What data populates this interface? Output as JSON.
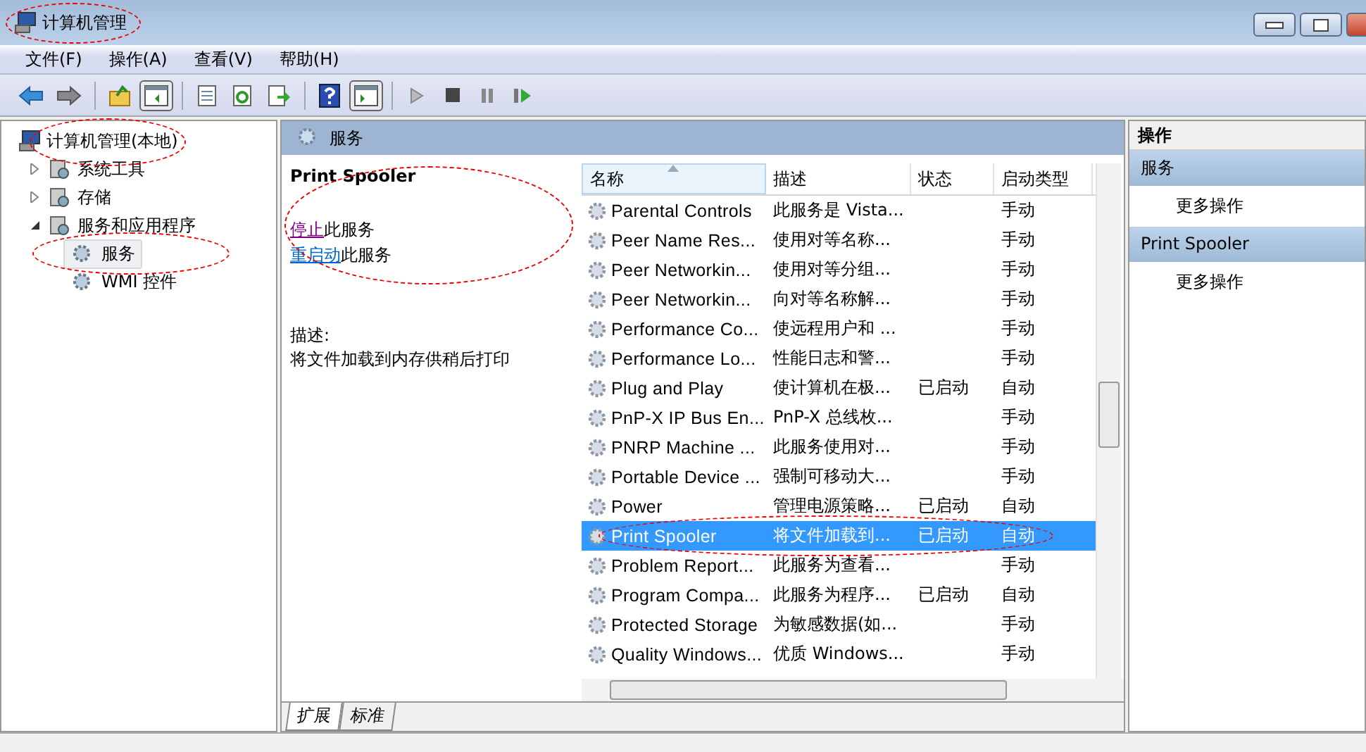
{
  "window": {
    "title": "计算机管理",
    "circled": true
  },
  "menu": [
    "文件(F)",
    "操作(A)",
    "查看(V)",
    "帮助(H)"
  ],
  "tree": [
    {
      "label": "计算机管理(本地)",
      "circled": true,
      "children": [
        {
          "label": "系统工具",
          "expanded": false
        },
        {
          "label": "存储",
          "expanded": false
        },
        {
          "label": "服务和应用程序",
          "expanded": true,
          "children": [
            {
              "label": "服务",
              "selected": true,
              "circled": true
            },
            {
              "label": "WMI 控件",
              "selected": false,
              "circled": false
            }
          ]
        }
      ]
    }
  ],
  "header": {
    "title": "服务"
  },
  "details": {
    "name": "Print Spooler",
    "circled": true,
    "links": [
      {
        "link": "停止",
        "rest": "此服务",
        "visited": true
      },
      {
        "link": "重启动",
        "rest": "此服务",
        "visited": false
      }
    ],
    "description_label": "描述:",
    "description": "将文件加载到内存供稍后打印"
  },
  "table": {
    "columns": [
      {
        "label": "名称",
        "sorted": true
      },
      {
        "label": "描述",
        "sorted": false
      },
      {
        "label": "状态",
        "sorted": false
      },
      {
        "label": "启动类型",
        "sorted": false
      }
    ],
    "rows": [
      {
        "name": "Parental Controls",
        "description": "此服务是 Vista...",
        "startup": "手动",
        "selected": false,
        "circled": false
      },
      {
        "name": "Peer Name Res...",
        "description": "使用对等名称...",
        "startup": "手动",
        "selected": false,
        "circled": false
      },
      {
        "name": "Peer Networkin...",
        "description": "使用对等分组...",
        "startup": "手动",
        "selected": false,
        "circled": false
      },
      {
        "name": "Peer Networkin...",
        "description": "向对等名称解...",
        "startup": "手动",
        "selected": false,
        "circled": false
      },
      {
        "name": "Performance Co...",
        "description": "使远程用户和 ...",
        "startup": "手动",
        "selected": false,
        "circled": false
      },
      {
        "name": "Performance Lo...",
        "description": "性能日志和警...",
        "startup": "手动",
        "selected": false,
        "circled": false
      },
      {
        "name": "Plug and Play",
        "description": "使计算机在极...",
        "status": "已启动",
        "startup": "自动",
        "selected": false,
        "circled": false
      },
      {
        "name": "PnP-X IP Bus En...",
        "description": "PnP-X 总线枚...",
        "startup": "手动",
        "selected": false,
        "circled": false
      },
      {
        "name": "PNRP Machine ...",
        "description": "此服务使用对...",
        "startup": "手动",
        "selected": false,
        "circled": false
      },
      {
        "name": "Portable Device ...",
        "description": "强制可移动大...",
        "startup": "手动",
        "selected": false,
        "circled": false
      },
      {
        "name": "Power",
        "description": "管理电源策略...",
        "status": "已启动",
        "startup": "自动",
        "selected": false,
        "circled": false
      },
      {
        "name": "Print Spooler",
        "description": "将文件加载到...",
        "status": "已启动",
        "startup": "自动",
        "selected": true,
        "circled": true
      },
      {
        "name": "Problem Report...",
        "description": "此服务为查看...",
        "startup": "手动",
        "selected": false,
        "circled": false
      },
      {
        "name": "Program Compa...",
        "description": "此服务为程序...",
        "status": "已启动",
        "startup": "自动",
        "selected": false,
        "circled": false
      },
      {
        "name": "Protected Storage",
        "description": "为敏感数据(如...",
        "startup": "手动",
        "selected": false,
        "circled": false
      },
      {
        "name": "Quality Windows...",
        "description": "优质 Windows...",
        "startup": "手动",
        "selected": false,
        "circled": false
      }
    ]
  },
  "tabs": [
    {
      "label": "扩展",
      "selected": true
    },
    {
      "label": "标准",
      "selected": false
    }
  ],
  "actions": {
    "title": "操作",
    "groups": [
      {
        "title": "服务",
        "items": [
          "更多操作"
        ]
      },
      {
        "title": "Print Spooler",
        "items": [
          "更多操作"
        ]
      }
    ]
  }
}
